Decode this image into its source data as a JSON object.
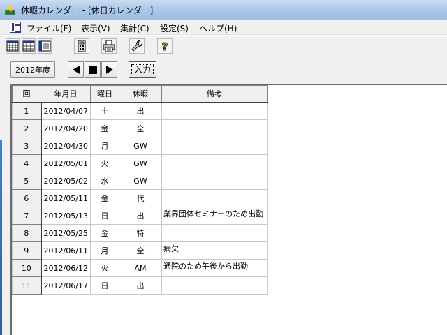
{
  "window": {
    "title": "休暇カレンダー - [休日カレンダー]"
  },
  "menu": {
    "items": [
      {
        "label": "ファイル(F)"
      },
      {
        "label": "表示(V)"
      },
      {
        "label": "集計(C)"
      },
      {
        "label": "設定(S)"
      },
      {
        "label": "ヘルプ(H)"
      }
    ]
  },
  "toolbar": {
    "buttons": [
      {
        "icon": "grid-calendar-icon"
      },
      {
        "icon": "month-calendar-icon"
      },
      {
        "icon": "list-view-icon"
      },
      {
        "icon": "calculator-icon"
      },
      {
        "icon": "printer-icon"
      },
      {
        "icon": "wrench-icon"
      },
      {
        "icon": "help-icon"
      }
    ]
  },
  "nav": {
    "year_label": "2012年度",
    "input_label": "入力"
  },
  "table": {
    "headers": [
      "回",
      "年月日",
      "曜日",
      "休暇",
      "備考"
    ],
    "rows": [
      {
        "num": "1",
        "date": "2012/04/07",
        "weekday": "土",
        "leave": "出",
        "note": ""
      },
      {
        "num": "2",
        "date": "2012/04/20",
        "weekday": "金",
        "leave": "全",
        "note": ""
      },
      {
        "num": "3",
        "date": "2012/04/30",
        "weekday": "月",
        "leave": "GW",
        "note": ""
      },
      {
        "num": "4",
        "date": "2012/05/01",
        "weekday": "火",
        "leave": "GW",
        "note": ""
      },
      {
        "num": "5",
        "date": "2012/05/02",
        "weekday": "水",
        "leave": "GW",
        "note": ""
      },
      {
        "num": "6",
        "date": "2012/05/11",
        "weekday": "金",
        "leave": "代",
        "note": ""
      },
      {
        "num": "7",
        "date": "2012/05/13",
        "weekday": "日",
        "leave": "出",
        "note": "業界団体セミナーのため出勤"
      },
      {
        "num": "8",
        "date": "2012/05/25",
        "weekday": "金",
        "leave": "特",
        "note": ""
      },
      {
        "num": "9",
        "date": "2012/06/11",
        "weekday": "月",
        "leave": "全",
        "note": "病欠"
      },
      {
        "num": "10",
        "date": "2012/06/12",
        "weekday": "火",
        "leave": "AM",
        "note": "通院のため午後から出勤"
      },
      {
        "num": "11",
        "date": "2012/06/17",
        "weekday": "日",
        "leave": "出",
        "note": ""
      }
    ]
  }
}
